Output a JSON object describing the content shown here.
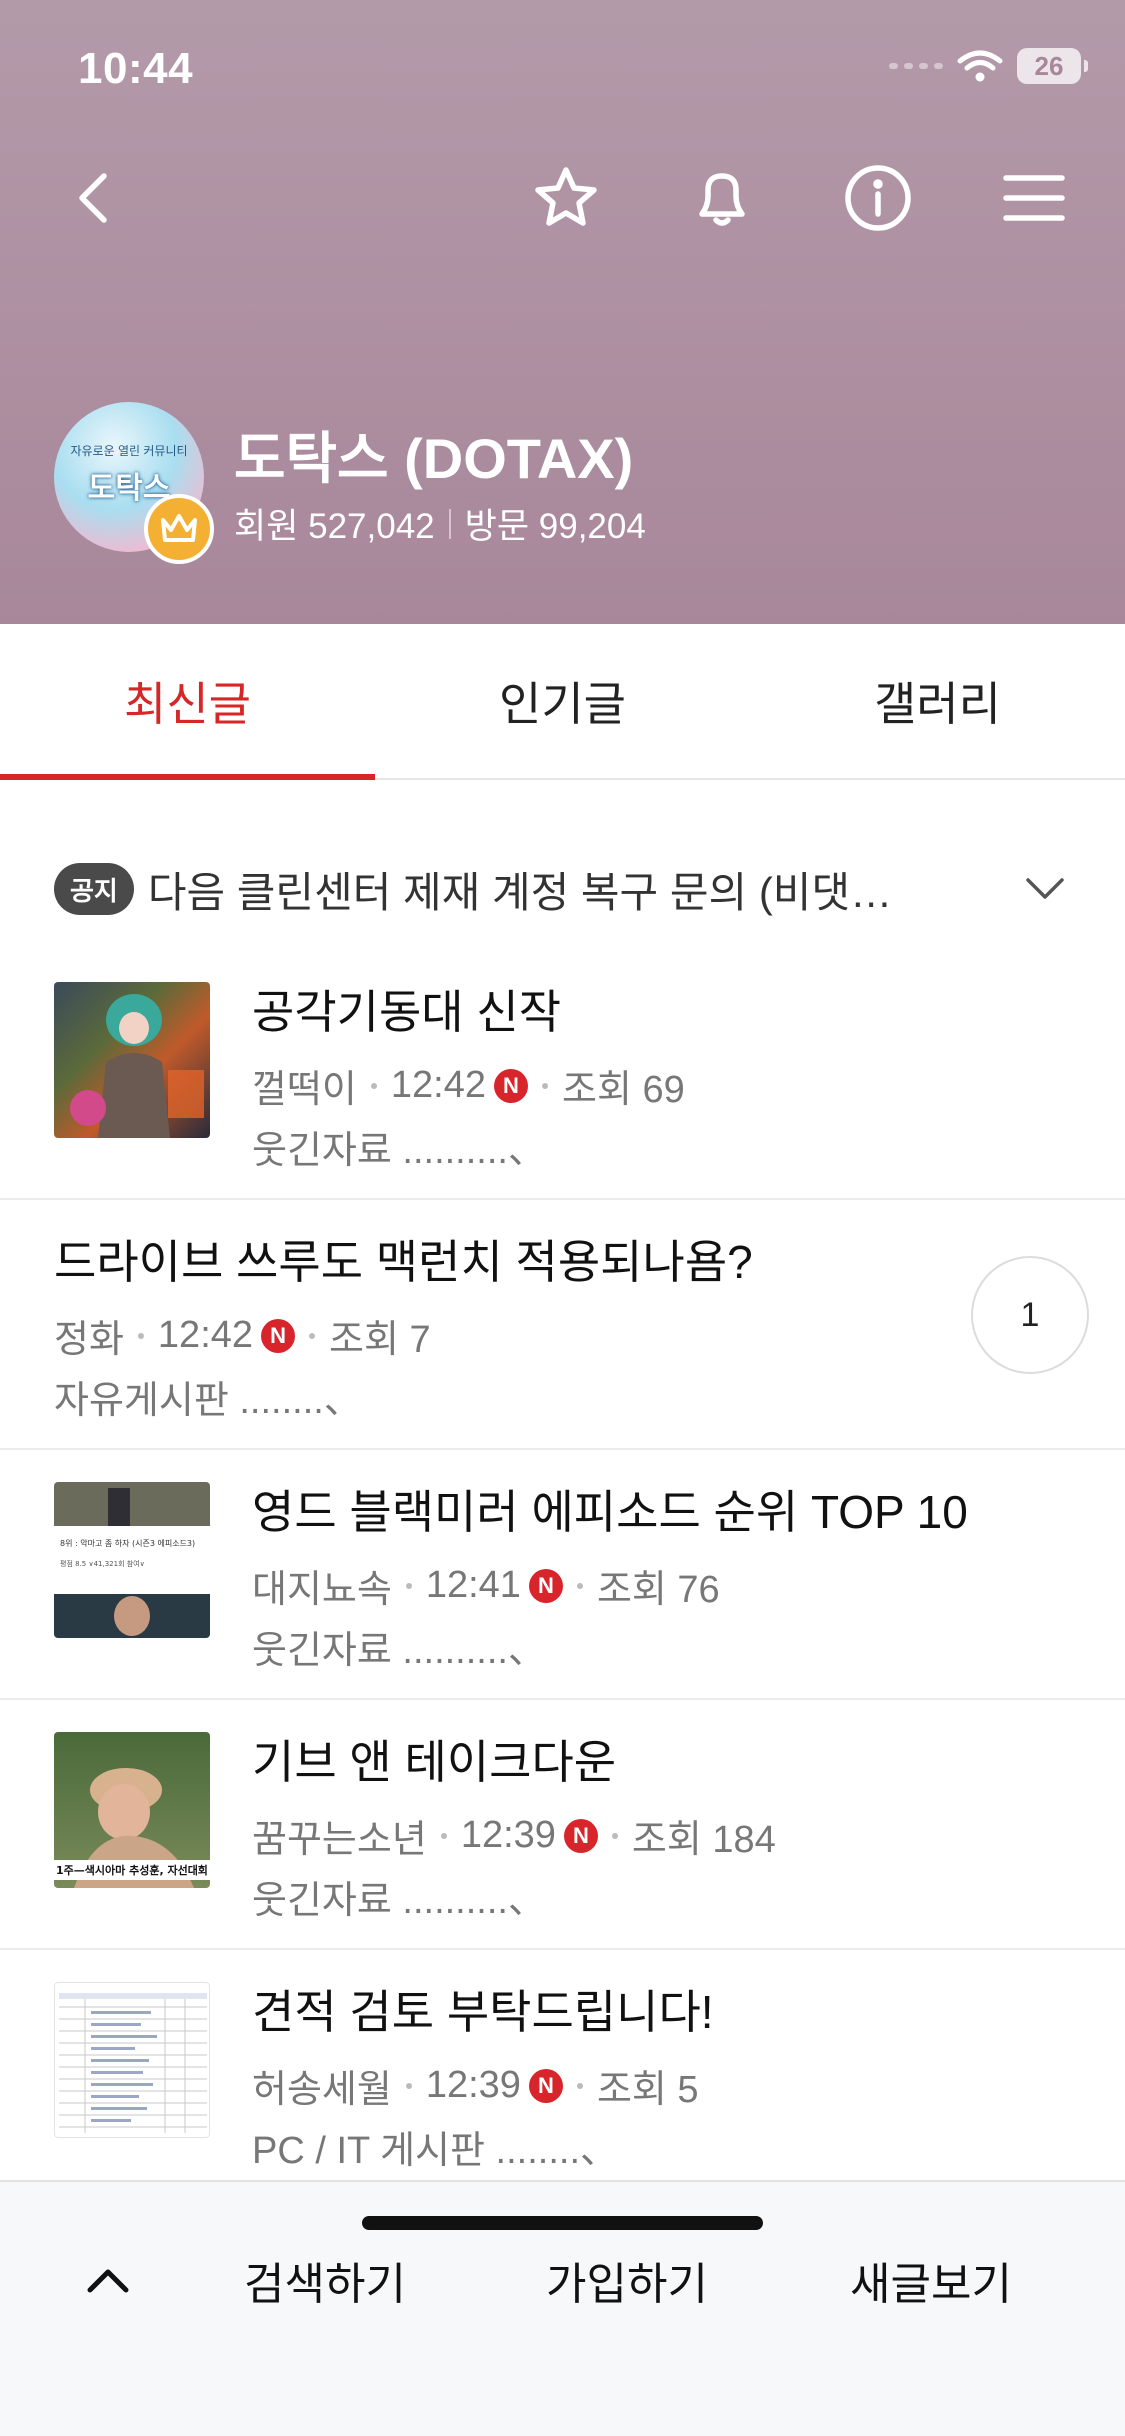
{
  "status_bar": {
    "time": "10:44",
    "battery": "26"
  },
  "cafe": {
    "name": "도탁스 (DOTAX)",
    "members_label": "회원 527,042",
    "visits_label": "방문 99,204",
    "avatar_text": "도탁스",
    "avatar_subtext": "자유로운 열린 커뮤니티"
  },
  "tabs": [
    {
      "label": "최신글",
      "active": true
    },
    {
      "label": "인기글",
      "active": false
    },
    {
      "label": "갤러리",
      "active": false
    }
  ],
  "notice": {
    "badge": "공지",
    "text": "다음 클린센터 제재 계정 복구 문의 (비댓…"
  },
  "posts": [
    {
      "title": "공각기동대 신작",
      "author": "껄떡이",
      "time": "12:42",
      "new_badge": "N",
      "views": "조회 69",
      "board": "웃긴자료 ..........、",
      "has_thumb": true
    },
    {
      "title": "드라이브 쓰루도 맥런치 적용되나욤?",
      "author": "정화",
      "time": "12:42",
      "new_badge": "N",
      "views": "조회 7",
      "board": "자유게시판 ........、",
      "has_thumb": false,
      "comments": "1"
    },
    {
      "title": "영드 블랙미러 에피소드 순위 TOP 10",
      "author": "대지뇨속",
      "time": "12:41",
      "new_badge": "N",
      "views": "조회 76",
      "board": "웃긴자료 ..........、",
      "has_thumb": true
    },
    {
      "title": "기브 앤 테이크다운",
      "author": "꿈꾸는소년",
      "time": "12:39",
      "new_badge": "N",
      "views": "조회 184",
      "board": "웃긴자료 ..........、",
      "has_thumb": true
    },
    {
      "title": "견적 검토 부탁드립니다!",
      "author": "허송세월",
      "time": "12:39",
      "new_badge": "N",
      "views": "조회 5",
      "board": "PC / IT 게시판 ........、",
      "has_thumb": true
    }
  ],
  "thumb_texts": {
    "post3_top": "8위 : 악마고 좀 하자 (시즌3 에피소드3)",
    "post3_mid": "평점 8.5 ∨41,321회 참여∨",
    "post4_caption": "1주—색시아마 추성훈, 자선대회 1"
  },
  "bottom_bar": {
    "search": "검색하기",
    "join": "가입하기",
    "new_posts": "새글보기"
  },
  "colors": {
    "header": "#ab8c9e",
    "accent": "#d62626",
    "new_badge": "#d8242b",
    "crown": "#f4b032"
  }
}
